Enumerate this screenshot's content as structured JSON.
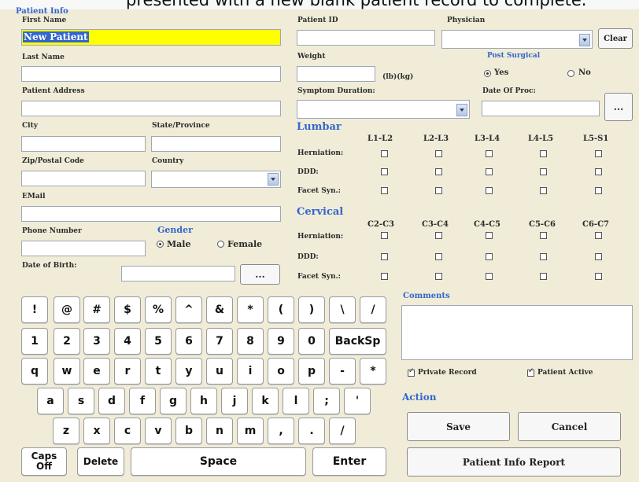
{
  "caption": "presented with a new blank patient record to complete.",
  "patient_info": {
    "section_title": "Patient Info",
    "first_name_label": "First Name",
    "first_name_value": "New Patient",
    "last_name_label": "Last Name",
    "address_label": "Patient Address",
    "city_label": "City",
    "state_label": "State/Province",
    "zip_label": "Zip/Postal Code",
    "country_label": "Country",
    "email_label": "EMail",
    "phone_label": "Phone Number",
    "dob_label": "Date of Birth:",
    "dob_button": "...",
    "gender": {
      "title": "Gender",
      "male": "Male",
      "female": "Female",
      "selected": "Male"
    }
  },
  "right_top": {
    "patient_id_label": "Patient ID",
    "physician_label": "Physician",
    "clear_button": "Clear",
    "weight_label": "Weight",
    "weight_unit": "(lb)(kg)",
    "post_surgical": {
      "title": "Post Surgical",
      "yes": "Yes",
      "no": "No",
      "selected": "Yes"
    },
    "symptom_duration_label": "Symptom Duration:",
    "date_of_proc_label": "Date Of Proc:",
    "date_button": "..."
  },
  "lumbar": {
    "title": "Lumbar",
    "columns": [
      "L1-L2",
      "L2-L3",
      "L3-L4",
      "L4-L5",
      "L5-S1"
    ],
    "rows": [
      "Herniation:",
      "DDD:",
      "Facet Syn.:"
    ]
  },
  "cervical": {
    "title": "Cervical",
    "columns": [
      "C2-C3",
      "C3-C4",
      "C4-C5",
      "C5-C6",
      "C6-C7"
    ],
    "rows": [
      "Herniation:",
      "DDD:",
      "Facet Syn.:"
    ]
  },
  "comments_label": "Comments",
  "private_record_label": "Private Record",
  "patient_active_label": "Patient Active",
  "action": {
    "title": "Action",
    "save": "Save",
    "cancel": "Cancel",
    "report": "Patient Info Report"
  },
  "keyboard": {
    "row1": [
      "!",
      "@",
      "#",
      "$",
      "%",
      "^",
      "&",
      "*",
      "(",
      ")",
      "\\",
      "/"
    ],
    "row2": [
      "1",
      "2",
      "3",
      "4",
      "5",
      "6",
      "7",
      "8",
      "9",
      "0"
    ],
    "backspace": "BackSp",
    "row3": [
      "q",
      "w",
      "e",
      "r",
      "t",
      "y",
      "u",
      "i",
      "o",
      "p",
      "-",
      "*"
    ],
    "row4": [
      "a",
      "s",
      "d",
      "f",
      "g",
      "h",
      "j",
      "k",
      "l",
      ";",
      "'"
    ],
    "row5": [
      "z",
      "x",
      "c",
      "v",
      "b",
      "n",
      "m",
      ",",
      ".",
      "/"
    ],
    "caps": "Caps\nOff",
    "delete": "Delete",
    "space": "Space",
    "enter": "Enter"
  }
}
